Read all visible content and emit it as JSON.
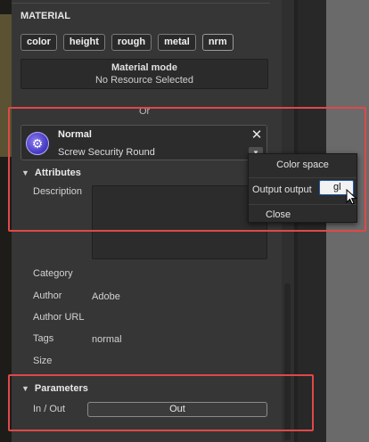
{
  "section": {
    "title": "MATERIAL"
  },
  "chips": [
    "color",
    "height",
    "rough",
    "metal",
    "nrm"
  ],
  "material_mode": {
    "title": "Material mode",
    "value": "No Resource Selected"
  },
  "separator_text": "Or",
  "resource_card": {
    "title": "Normal",
    "subtitle": "Screw Security Round"
  },
  "attributes": {
    "header": "Attributes",
    "rows": [
      {
        "label": "Description",
        "value": ""
      },
      {
        "label": "Category",
        "value": ""
      },
      {
        "label": "Author",
        "value": "Adobe"
      },
      {
        "label": "Author URL",
        "value": ""
      },
      {
        "label": "Tags",
        "value": "normal"
      },
      {
        "label": "Size",
        "value": ""
      }
    ]
  },
  "parameters": {
    "header": "Parameters",
    "inout_label": "In / Out",
    "button": "Out"
  },
  "popup": {
    "color_space": "Color space",
    "output_label": "Output output",
    "output_value": "gl",
    "close": "Close"
  },
  "colors": {
    "accent_red": "#e04848",
    "icon_purple": "#5a4ad8"
  }
}
